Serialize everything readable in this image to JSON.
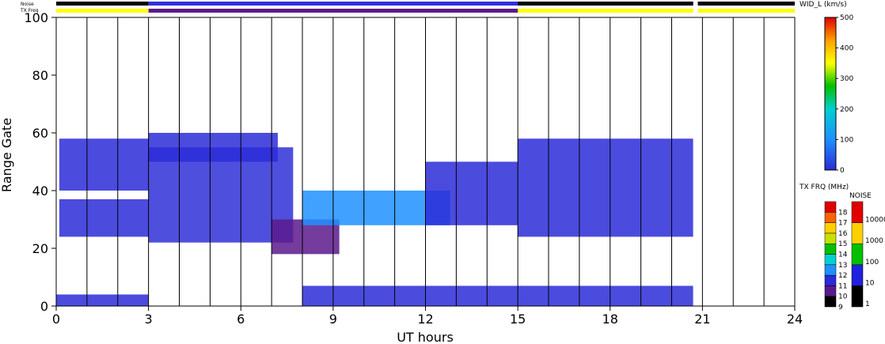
{
  "chart_data": {
    "type": "heatmap",
    "title": "",
    "xlabel": "UT hours",
    "ylabel": "Range Gate",
    "xlim": [
      0,
      24
    ],
    "ylim": [
      0,
      100
    ],
    "x_ticks": [
      "0",
      "3",
      "6",
      "9",
      "12",
      "15",
      "18",
      "21",
      "24"
    ],
    "y_ticks": [
      "0",
      "20",
      "40",
      "60",
      "80",
      "100"
    ],
    "strip_labels": {
      "noise": "Noise",
      "tx_freq": "TX Freq"
    },
    "colorbars": {
      "width": {
        "title": "WID_L (km/s)",
        "ticks": [
          "0",
          "100",
          "200",
          "300",
          "400",
          "500"
        ],
        "range": [
          0,
          500
        ]
      },
      "tx_freq": {
        "title": "TX FRQ (MHz)",
        "levels": [
          "9",
          "10",
          "11",
          "12",
          "13",
          "14",
          "15",
          "16",
          "17",
          "18"
        ],
        "colors": [
          "#000000",
          "#5a1a8c",
          "#2b2bd8",
          "#1e90ff",
          "#00d0d0",
          "#00c000",
          "#c8e000",
          "#ffd000",
          "#ff6000",
          "#e00000"
        ]
      },
      "noise": {
        "title": "NOISE",
        "levels": [
          "1",
          "10",
          "100",
          "1000",
          "10000"
        ],
        "colors": [
          "#000000",
          "#2020e0",
          "#00c000",
          "#ffd000",
          "#e00000"
        ]
      }
    },
    "tx_freq_strip": [
      {
        "start": 0,
        "end": 3,
        "color": "#ffff00"
      },
      {
        "start": 3,
        "end": 15,
        "color": "#5a1a8c"
      },
      {
        "start": 15,
        "end": 20.7,
        "color": "#ffff00"
      },
      {
        "start": 20.85,
        "end": 24,
        "color": "#ffff00"
      }
    ],
    "noise_strip": [
      {
        "start": 0,
        "end": 3,
        "color": "#000000"
      },
      {
        "start": 3,
        "end": 15,
        "color": "#3030e0"
      },
      {
        "start": 15,
        "end": 20.7,
        "color": "#000000"
      },
      {
        "start": 20.85,
        "end": 24,
        "color": "#000000"
      }
    ],
    "vertical_lines_hours": [
      1,
      2,
      3,
      4,
      5,
      6,
      7,
      8,
      9,
      10,
      11,
      12,
      13,
      14,
      15,
      16,
      17,
      18,
      19,
      20,
      21,
      22,
      23
    ],
    "data_gap": [
      20.7,
      20.85
    ],
    "echo_regions": [
      {
        "name": "early band",
        "t0": 0.1,
        "t1": 3.0,
        "g0": 40,
        "g1": 58,
        "color": "#2b2bd8"
      },
      {
        "name": "early lower band",
        "t0": 0.1,
        "t1": 3.0,
        "g0": 24,
        "g1": 37,
        "color": "#2b2bd8"
      },
      {
        "name": "rising band",
        "t0": 3.0,
        "t1": 7.7,
        "g0": 22,
        "g1": 55,
        "color": "#3030d8"
      },
      {
        "name": "upper band",
        "t0": 3.0,
        "t1": 7.2,
        "g0": 50,
        "g1": 60,
        "color": "#2b2bd8"
      },
      {
        "name": "mid band",
        "t0": 7.0,
        "t1": 9.2,
        "g0": 18,
        "g1": 30,
        "color": "#5a1a8c"
      },
      {
        "name": "central patch",
        "t0": 8.0,
        "t1": 12.8,
        "g0": 28,
        "g1": 40,
        "color": "#1e90ff"
      },
      {
        "name": "descending band",
        "t0": 12.0,
        "t1": 15.0,
        "g0": 28,
        "g1": 50,
        "color": "#2b2bd8"
      },
      {
        "name": "late band",
        "t0": 15.0,
        "t1": 20.7,
        "g0": 24,
        "g1": 58,
        "color": "#2b2bd8"
      },
      {
        "name": "near range",
        "t0": 8.0,
        "t1": 20.7,
        "g0": 0,
        "g1": 7,
        "color": "#2b2bd8"
      },
      {
        "name": "near range early",
        "t0": 0.0,
        "t1": 3.0,
        "g0": 0,
        "g1": 4,
        "color": "#2b2bd8"
      }
    ]
  }
}
